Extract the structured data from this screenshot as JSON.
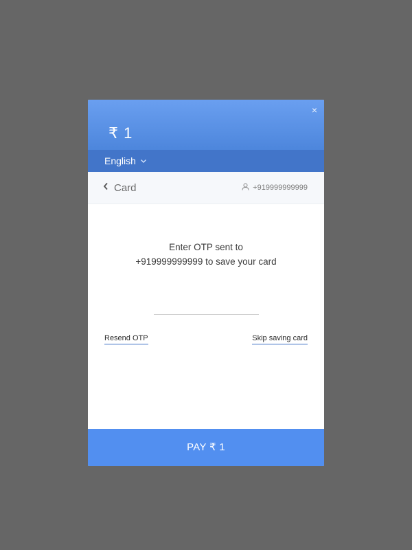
{
  "header": {
    "amount": "₹ 1",
    "close_symbol": "×"
  },
  "language": {
    "selected": "English"
  },
  "subbar": {
    "back_label": "Card",
    "contact": "+919999999999"
  },
  "otp": {
    "line1": "Enter OTP sent to",
    "line2": "+919999999999 to save your card",
    "input_value": "",
    "input_placeholder": ""
  },
  "links": {
    "resend": "Resend OTP",
    "skip": "Skip saving card"
  },
  "pay_button": {
    "label": "PAY ₹ 1"
  },
  "colors": {
    "header_top": "#6a9ff0",
    "header_bottom": "#4d86dc",
    "lang_bar": "#4275c9",
    "pay_button": "#528ff0",
    "overlay": "#666666"
  },
  "icons": {
    "close": "close-icon",
    "chevron": "chevron-down-icon",
    "back": "chevron-left-icon",
    "user": "user-icon"
  }
}
